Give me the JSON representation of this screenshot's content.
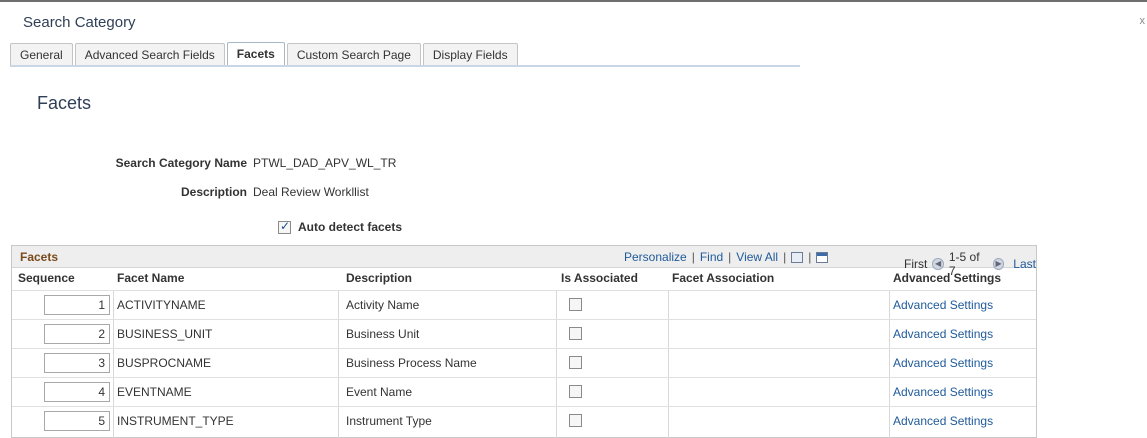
{
  "window": {
    "title": "Search Category",
    "close_glyph": "x"
  },
  "tabs": [
    {
      "label": "General",
      "active": false
    },
    {
      "label": "Advanced Search Fields",
      "active": false
    },
    {
      "label": "Facets",
      "active": true
    },
    {
      "label": "Custom Search Page",
      "active": false
    },
    {
      "label": "Display Fields",
      "active": false
    }
  ],
  "page": {
    "title": "Facets",
    "search_category_name_label": "Search Category Name",
    "search_category_name_value": "PTWL_DAD_APV_WL_TR",
    "description_label": "Description",
    "description_value": "Deal Review Workllist",
    "auto_detect_label": "Auto detect facets",
    "auto_detect_checked": true
  },
  "grid": {
    "title": "Facets",
    "tools": {
      "personalize": "Personalize",
      "find": "Find",
      "view_all": "View All",
      "separator": "|"
    },
    "pager": {
      "first": "First",
      "range": "1-5 of 7",
      "last": "Last"
    },
    "columns": {
      "sequence": "Sequence",
      "facet_name": "Facet Name",
      "description": "Description",
      "is_associated": "Is Associated",
      "facet_association": "Facet Association",
      "advanced_settings": "Advanced Settings"
    },
    "rows": [
      {
        "sequence": "1",
        "facet_name": "ACTIVITYNAME",
        "description": "Activity Name",
        "advanced": "Advanced Settings"
      },
      {
        "sequence": "2",
        "facet_name": "BUSINESS_UNIT",
        "description": "Business Unit",
        "advanced": "Advanced Settings"
      },
      {
        "sequence": "3",
        "facet_name": "BUSPROCNAME",
        "description": "Business Process Name",
        "advanced": "Advanced Settings"
      },
      {
        "sequence": "4",
        "facet_name": "EVENTNAME",
        "description": "Event Name",
        "advanced": "Advanced Settings"
      },
      {
        "sequence": "5",
        "facet_name": "INSTRUMENT_TYPE",
        "description": "Instrument Type",
        "advanced": "Advanced Settings"
      }
    ]
  },
  "colors": {
    "link": "#1f5a9a",
    "grid_title": "#7a4a1c",
    "page_title": "#2f3f57"
  }
}
